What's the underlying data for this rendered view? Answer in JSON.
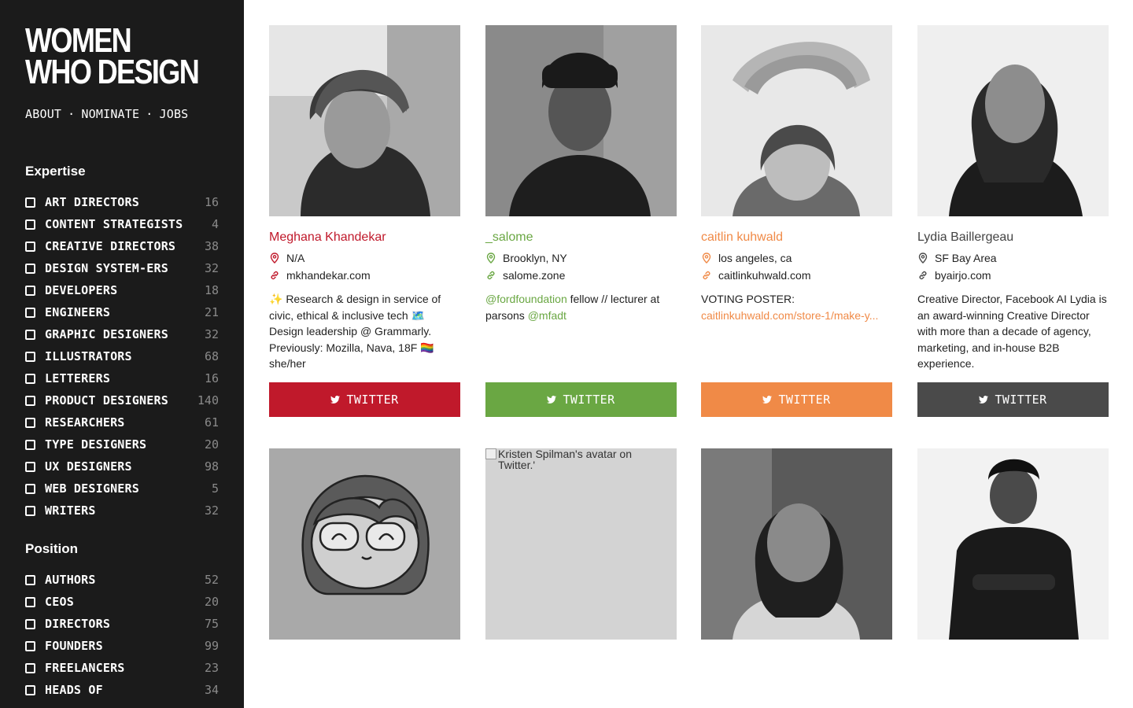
{
  "brand": {
    "line1": "WOMEN",
    "line2": "WHO DESIGN"
  },
  "nav": {
    "about": "ABOUT",
    "nominate": "NOMINATE",
    "jobs": "JOBS",
    "separator": "·"
  },
  "expertise": {
    "title": "Expertise",
    "items": [
      {
        "label": "ART DIRECTORS",
        "count": "16"
      },
      {
        "label": "CONTENT STRATEGISTS",
        "count": "4"
      },
      {
        "label": "CREATIVE DIRECTORS",
        "count": "38"
      },
      {
        "label": "DESIGN SYSTEM-ERS",
        "count": "32"
      },
      {
        "label": "DEVELOPERS",
        "count": "18"
      },
      {
        "label": "ENGINEERS",
        "count": "21"
      },
      {
        "label": "GRAPHIC DESIGNERS",
        "count": "32"
      },
      {
        "label": "ILLUSTRATORS",
        "count": "68"
      },
      {
        "label": "LETTERERS",
        "count": "16"
      },
      {
        "label": "PRODUCT DESIGNERS",
        "count": "140"
      },
      {
        "label": "RESEARCHERS",
        "count": "61"
      },
      {
        "label": "TYPE DESIGNERS",
        "count": "20"
      },
      {
        "label": "UX DESIGNERS",
        "count": "98"
      },
      {
        "label": "WEB DESIGNERS",
        "count": "5"
      },
      {
        "label": "WRITERS",
        "count": "32"
      }
    ]
  },
  "position": {
    "title": "Position",
    "items": [
      {
        "label": "AUTHORS",
        "count": "52"
      },
      {
        "label": "CEOS",
        "count": "20"
      },
      {
        "label": "DIRECTORS",
        "count": "75"
      },
      {
        "label": "FOUNDERS",
        "count": "99"
      },
      {
        "label": "FREELANCERS",
        "count": "23"
      },
      {
        "label": "HEADS OF",
        "count": "34"
      }
    ]
  },
  "cards": [
    {
      "name": "Meghana Khandekar",
      "location": "N/A",
      "website": "mkhandekar.com",
      "bio": "✨ Research & design in service of civic, ethical & inclusive tech 🗺️ Design leadership @ Grammarly. Previously: Mozilla, Nava, 18F 🏳️‍🌈 she/her",
      "button": "TWITTER",
      "accent": "#c0192b"
    },
    {
      "name": "_salome",
      "location": "Brooklyn, NY",
      "website": "salome.zone",
      "bio_link1": "@fordfoundation",
      "bio_mid": " fellow // lecturer at parsons ",
      "bio_link2": "@mfadt",
      "button": "TWITTER",
      "accent": "#6aa743"
    },
    {
      "name": "caitlin kuhwald",
      "location": "los angeles, ca",
      "website": "caitlinkuhwald.com",
      "bio": "VOTING POSTER:",
      "bio_link": "caitlinkuhwald.com/store-1/make-y...",
      "button": "TWITTER",
      "accent": "#f08a47"
    },
    {
      "name": "Lydia Baillergeau",
      "location": "SF Bay Area",
      "website": "byairjo.com",
      "bio": "Creative Director, Facebook AI Lydia is an award-winning Creative Director with more than a decade of agency, marketing, and in-house B2B experience.",
      "button": "TWITTER",
      "accent": "#4a4a4a"
    },
    {
      "alt": ""
    },
    {
      "alt": "Kristen Spilman's avatar on Twitter.'"
    },
    {
      "alt": ""
    },
    {
      "alt": ""
    }
  ]
}
